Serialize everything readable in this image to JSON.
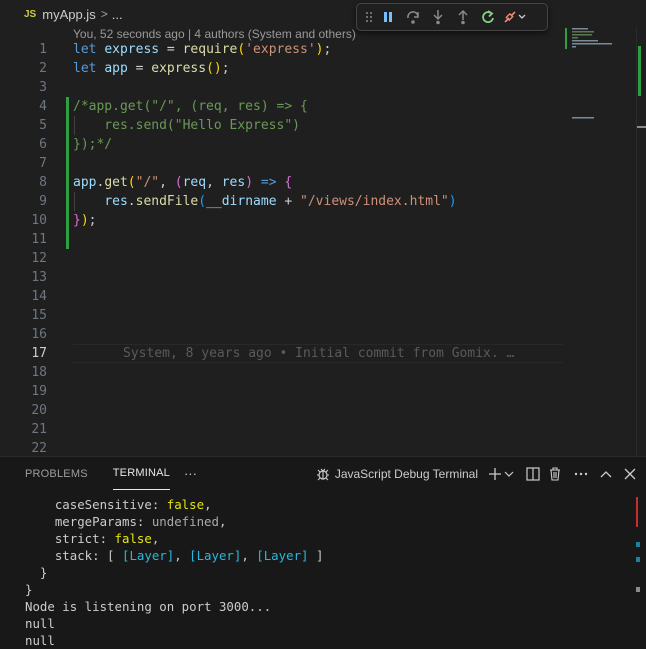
{
  "breadcrumb": {
    "lang_badge": "JS",
    "file_name": "myApp.js",
    "separator": ">",
    "more": "..."
  },
  "debug_toolbar": {
    "buttons": [
      "grip-icon",
      "pause-icon",
      "step-over-icon",
      "step-into-icon",
      "step-out-icon",
      "restart-icon",
      "disconnect-icon"
    ],
    "colors": {
      "accent": "#75beff",
      "restart": "#89d185",
      "disconnect": "#f48771"
    }
  },
  "editor": {
    "blame_header": "You, 52 seconds ago | 4 authors (System and others)",
    "line_numbers": [
      "1",
      "2",
      "3",
      "4",
      "5",
      "6",
      "7",
      "8",
      "9",
      "10",
      "11",
      "12",
      "13",
      "14",
      "15",
      "16",
      "17",
      "18",
      "19",
      "20",
      "21",
      "22"
    ],
    "active_line": "17",
    "inline_blame": "System, 8 years ago • Initial commit from Gomix. …",
    "code": {
      "l1": {
        "kw": "let",
        "var": "express",
        "eq": " = ",
        "fn": "require",
        "open": "(",
        "str": "'express'",
        "close": ")",
        "end": ";"
      },
      "l2": {
        "kw": "let",
        "var": "app",
        "eq": " = ",
        "fn": "express",
        "parens": "()",
        "end": ";"
      },
      "l4": "/*app.get(\"/\", (req, res) => {",
      "l5": "    res.send(\"Hello Express\")",
      "l6": "});*/",
      "l8": {
        "obj": "app",
        "dot": ".",
        "fn": "get",
        "open": "(",
        "str": "\"/\"",
        "comma": ", ",
        "p_open": "(",
        "p1": "req",
        "sep": ", ",
        "p2": "res",
        "p_close": ")",
        "arrow": " => ",
        "brace": "{"
      },
      "l9": {
        "obj": "res",
        "dot": ".",
        "fn": "sendFile",
        "open": "(",
        "var": "__dirname",
        "plus": " + ",
        "str": "\"/views/index.html\"",
        "close": ")"
      },
      "l10": {
        "brace": "}",
        "paren": ")",
        "end": ";"
      }
    }
  },
  "panel": {
    "tabs": [
      "PROBLEMS",
      "TERMINAL"
    ],
    "active_tab": "TERMINAL",
    "more": "···",
    "terminal_name": "JavaScript Debug Terminal",
    "terminal_lines": {
      "t1_key": "caseSensitive: ",
      "t1_val": "false",
      "t1_end": ",",
      "t2_key": "mergeParams: ",
      "t2_val": "undefined",
      "t2_end": ",",
      "t3_key": "strict: ",
      "t3_val": "false",
      "t3_end": ",",
      "t4_key": "stack: [ ",
      "t4_a": "[Layer]",
      "t4_sep1": ", ",
      "t4_b": "[Layer]",
      "t4_sep2": ", ",
      "t4_c": "[Layer]",
      "t4_end": " ]",
      "t5": "}",
      "t6": "}",
      "t7": "Node is listening on port 3000...",
      "t8": "null",
      "t9": "null"
    }
  }
}
